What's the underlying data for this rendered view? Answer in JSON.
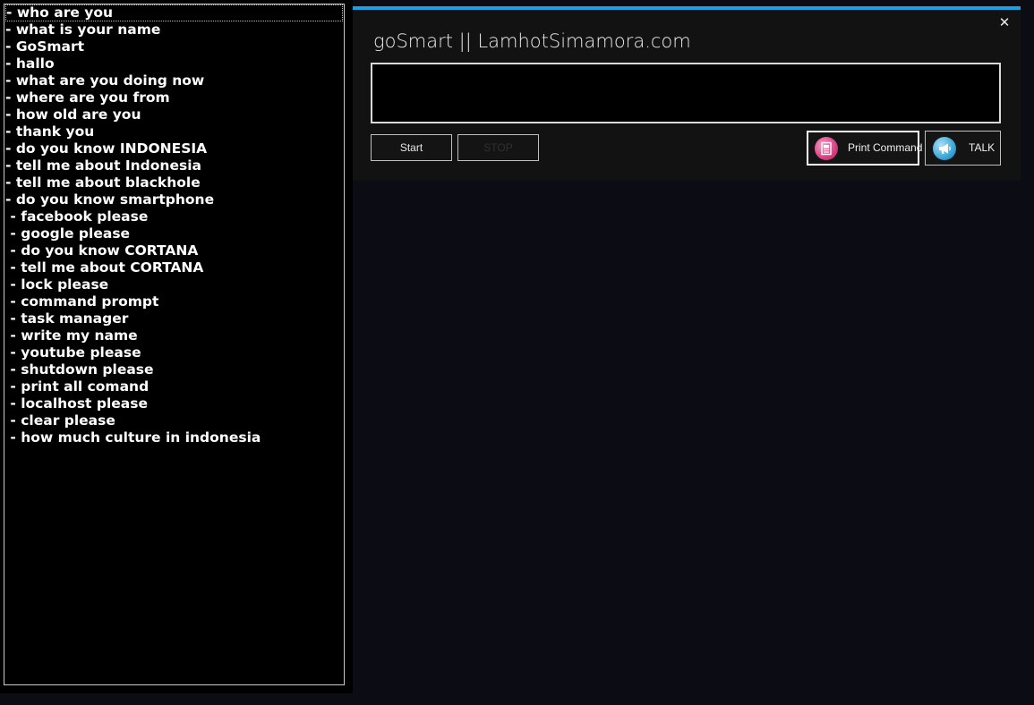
{
  "commands": [
    "- who are you",
    "- what is your name",
    "- GoSmart",
    "- hallo",
    "- what are you doing now",
    "- where are you from",
    "- how old are you",
    "- thank you",
    "- do you know INDONESIA",
    "- tell me about Indonesia",
    "- tell me about blackhole",
    "- do you know smartphone",
    " - facebook please",
    " - google please",
    " - do you know CORTANA",
    " - tell me about CORTANA",
    " - lock please",
    " - command prompt",
    " - task manager",
    " - write my name",
    " - youtube please",
    " - shutdown please",
    " - print all comand",
    " - localhost please",
    " - clear please",
    " - how much culture in indonesia"
  ],
  "selected_index": 0,
  "window": {
    "title": "goSmart || LamhotSimamora.com",
    "close_symbol": "✕",
    "accent_color": "#1ba1e2"
  },
  "input": {
    "value": ""
  },
  "buttons": {
    "start_label": "Start",
    "stop_label": "STOP",
    "print_label": "Print Command",
    "print_icon": "document-icon",
    "talk_label": "TALK",
    "talk_icon": "megaphone-icon"
  }
}
